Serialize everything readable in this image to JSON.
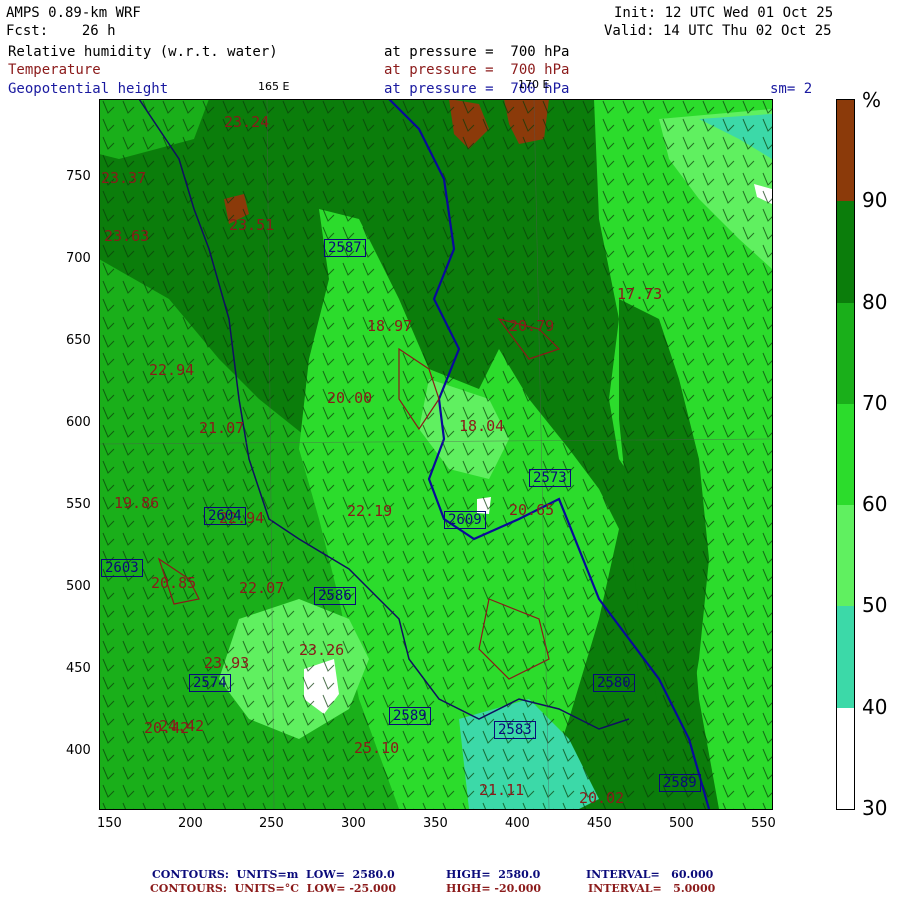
{
  "header": {
    "model": "AMPS 0.89-km WRF",
    "forecast": "Fcst:    26 h",
    "init": "Init: 12 UTC Wed 01 Oct 25",
    "valid": "Valid: 14 UTC Thu 02 Oct 25",
    "field1_name": "Relative humidity (w.r.t. water)",
    "field1_level": "at pressure =  700 hPa",
    "field2_name": "Temperature",
    "field2_level": "at pressure =  700 hPa",
    "field3_name": "Geopotential height",
    "field3_level": "at pressure =  700 hPa",
    "lon_label_1": "165 E",
    "lon_label_2": "170 E",
    "smoothing": "sm= 2"
  },
  "x_ticks": [
    "150",
    "200",
    "250",
    "300",
    "350",
    "400",
    "450",
    "500",
    "550"
  ],
  "y_ticks": [
    "750",
    "700",
    "650",
    "600",
    "550",
    "500",
    "450",
    "400"
  ],
  "colorbar": {
    "unit": "%",
    "labels": [
      "90",
      "80",
      "70",
      "60",
      "50",
      "40",
      "30"
    ],
    "colors": [
      "#8b3a0a",
      "#0b7d0b",
      "#1aaf1a",
      "#2cdc2c",
      "#60f060",
      "#3cd9a8",
      "#ffffff"
    ]
  },
  "map_labels": {
    "temps": [
      "23.24",
      "23.37",
      "23.63",
      "23.51",
      "22.07",
      "18.97",
      "20.79",
      "17.73",
      "22.94",
      "20.00",
      "18.04",
      "21.07",
      "19.86",
      "22.94",
      "22.19",
      "20.85",
      "23.26",
      "20.42",
      "23.93",
      "24.42",
      "25.10",
      "21.11",
      "20.02",
      "20.65"
    ],
    "heights": [
      "2587",
      "2604",
      "2603",
      "2586",
      "2574",
      "2609",
      "2580",
      "2589",
      "2583",
      "2589",
      "2573"
    ]
  },
  "footer": {
    "line1_a": "CONTOURS:  UNITS=m  LOW=  2580.0",
    "line1_b": "HIGH=  2580.0",
    "line1_c": "INTERVAL=   60.000",
    "line2_a": "CONTOURS:  UNITS=°C  LOW= -25.000",
    "line2_b": "HIGH= -20.000",
    "line2_c": "INTERVAL=   5.0000"
  }
}
